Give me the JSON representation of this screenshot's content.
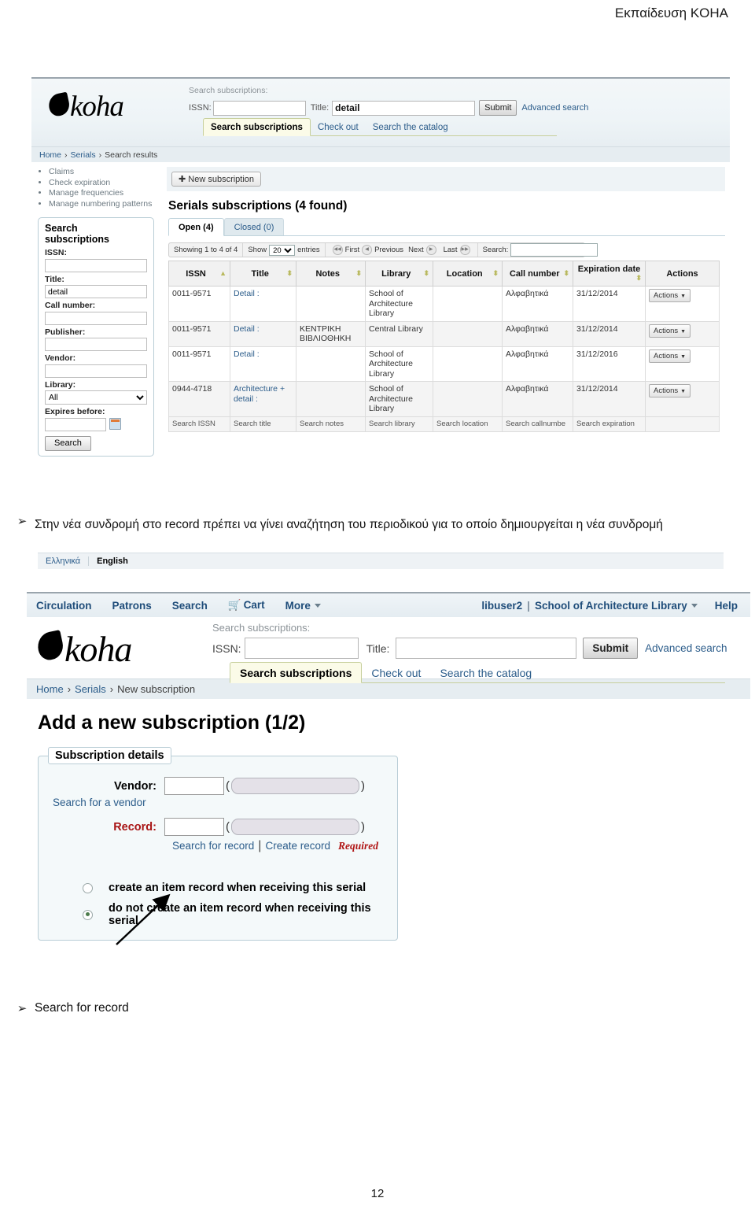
{
  "document": {
    "header_title": "Εκπαίδευση KOHA",
    "page_number": "12"
  },
  "instruction_1": {
    "bullet": "➢",
    "text": "Στην νέα συνδρομή στο record πρέπει να γίνει αναζήτηση του περιοδικού για το οποίο δημιουργείται η νέα συνδρομή"
  },
  "instruction_2": {
    "bullet": "➢",
    "text": "Search for record"
  },
  "screenshot1": {
    "logo": "koha",
    "search_subscriptions_label": "Search subscriptions:",
    "issn_label": "ISSN:",
    "issn_value": "",
    "title_label": "Title:",
    "title_value": "detail",
    "submit_label": "Submit",
    "advanced_search_label": "Advanced search",
    "subtabs": [
      {
        "label": "Search subscriptions",
        "active": true
      },
      {
        "label": "Check out",
        "active": false
      },
      {
        "label": "Search the catalog",
        "active": false
      }
    ],
    "breadcrumb": {
      "home": "Home",
      "sep": "›",
      "serials": "Serials",
      "current": "Search results"
    },
    "sidebar_links": [
      "Claims",
      "Check expiration",
      "Manage frequencies",
      "Manage numbering patterns"
    ],
    "search_panel": {
      "heading_line1": "Search",
      "heading_line2": "subscriptions",
      "issn_label": "ISSN:",
      "issn_value": "",
      "title_label": "Title:",
      "title_value": "detail",
      "callnumber_label": "Call number:",
      "callnumber_value": "",
      "publisher_label": "Publisher:",
      "publisher_value": "",
      "vendor_label": "Vendor:",
      "vendor_value": "",
      "library_label": "Library:",
      "library_value": "All",
      "library_options": [
        "All"
      ],
      "expires_label": "Expires before:",
      "expires_value": "",
      "calendar_icon": "calendar-icon",
      "search_button": "Search"
    },
    "new_subscription_button": "New subscription",
    "new_subscription_icon": "plus-icon",
    "page_heading": "Serials subscriptions (4 found)",
    "tabs": [
      {
        "label": "Open (4)",
        "active": true
      },
      {
        "label": "Closed (0)",
        "active": false
      }
    ],
    "datatable_toolbar": {
      "showing": "Showing 1 to 4 of 4",
      "show_label": "Show",
      "entries_value": "20",
      "entries_options": [
        "20"
      ],
      "entries_label": "entries",
      "first": "First",
      "previous": "Previous",
      "next": "Next",
      "last": "Last",
      "search_label": "Search:",
      "search_value": ""
    },
    "table": {
      "columns": [
        "ISSN",
        "Title",
        "Notes",
        "Library",
        "Location",
        "Call number",
        "Expiration date",
        "Actions"
      ],
      "rows": [
        {
          "issn": "0011-9571",
          "title": "Detail :",
          "notes": "",
          "library": "School of Architecture Library",
          "location": "",
          "callnumber": "Αλφαβητικά",
          "expiration": "31/12/2014",
          "action": "Actions"
        },
        {
          "issn": "0011-9571",
          "title": "Detail :",
          "notes": "ΚΕΝΤΡΙΚΗ ΒΙΒΛΙΟΘΗΚΗ",
          "library": "Central Library",
          "location": "",
          "callnumber": "Αλφαβητικά",
          "expiration": "31/12/2014",
          "action": "Actions"
        },
        {
          "issn": "0011-9571",
          "title": "Detail :",
          "notes": "",
          "library": "School of Architecture Library",
          "location": "",
          "callnumber": "Αλφαβητικά",
          "expiration": "31/12/2016",
          "action": "Actions"
        },
        {
          "issn": "0944-4718",
          "title": "Architecture + detail :",
          "notes": "",
          "library": "School of Architecture Library",
          "location": "",
          "callnumber": "Αλφαβητικά",
          "expiration": "31/12/2014",
          "action": "Actions"
        }
      ],
      "footer_filters": [
        "Search ISSN",
        "Search title",
        "Search notes",
        "Search library",
        "Search location",
        "Search callnumbe",
        "Search expiration"
      ]
    },
    "language_bar": {
      "greek": "Ελληνικά",
      "english": "English"
    }
  },
  "screenshot2": {
    "nav_items": [
      "Circulation",
      "Patrons",
      "Search",
      "Cart",
      "More"
    ],
    "cart_icon": "cart-icon",
    "more_caret_icon": "chevron-down-icon",
    "user": "libuser2",
    "user_separator": "|",
    "branch": "School of Architecture Library",
    "branch_caret_icon": "chevron-down-icon",
    "help": "Help",
    "logo": "koha",
    "search_subscriptions_label": "Search subscriptions:",
    "issn_label": "ISSN:",
    "issn_value": "",
    "title_label": "Title:",
    "title_value": "",
    "submit_label": "Submit",
    "advanced_search_label": "Advanced search",
    "subtabs": [
      {
        "label": "Search subscriptions",
        "active": true
      },
      {
        "label": "Check out",
        "active": false
      },
      {
        "label": "Search the catalog",
        "active": false
      }
    ],
    "breadcrumb": {
      "home": "Home",
      "sep": "›",
      "serials": "Serials",
      "current": "New subscription"
    },
    "page_heading": "Add a new subscription (1/2)",
    "fieldset_legend": "Subscription details",
    "vendor_label": "Vendor:",
    "vendor_value": "",
    "vendor_search_link": "Search for a vendor",
    "record_label": "Record:",
    "record_value": "",
    "record_search_link": "Search for record",
    "record_separator": "|",
    "record_create_link": "Create record",
    "required_text": "Required",
    "radio_options": [
      {
        "label": "create an item record when receiving this serial",
        "selected": false
      },
      {
        "label": "do not create an item record when receiving this serial",
        "selected": true
      }
    ],
    "annotation_arrow_icon": "arrow-pointer-icon"
  },
  "colors": {
    "link": "#2b5c8a",
    "required": "#b01515",
    "panel_border": "#b9cdd6",
    "breadcrumb_bg": "#e6edf1"
  }
}
